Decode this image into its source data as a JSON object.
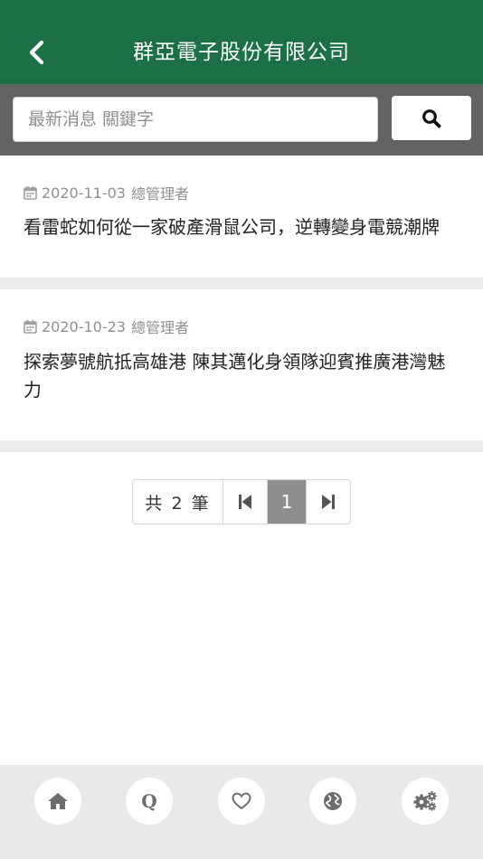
{
  "header": {
    "title": "群亞電子股份有限公司",
    "back_icon": "chevron-left-icon"
  },
  "search": {
    "placeholder": "最新消息 關鍵字",
    "value": "",
    "button_icon": "search-icon"
  },
  "news": [
    {
      "date": "2020-11-03",
      "author": "總管理者",
      "title": "看雷蛇如何從一家破產滑鼠公司，逆轉變身電競潮牌"
    },
    {
      "date": "2020-10-23",
      "author": "總管理者",
      "title": "探索夢號航抵高雄港 陳其邁化身領隊迎賓推廣港灣魅力"
    }
  ],
  "pagination": {
    "total_label": "共 2 筆",
    "current_page": "1"
  },
  "bottom_nav": [
    "home-icon",
    "q-icon",
    "heart-icon",
    "globe-icon",
    "gears-icon"
  ],
  "bottom_nav_q_label": "Q",
  "colors": {
    "header_bg": "#1b7045",
    "search_bar_bg": "#636363",
    "active_page_bg": "#8f8f8f",
    "bottom_nav_bg": "#e9e9e9"
  }
}
